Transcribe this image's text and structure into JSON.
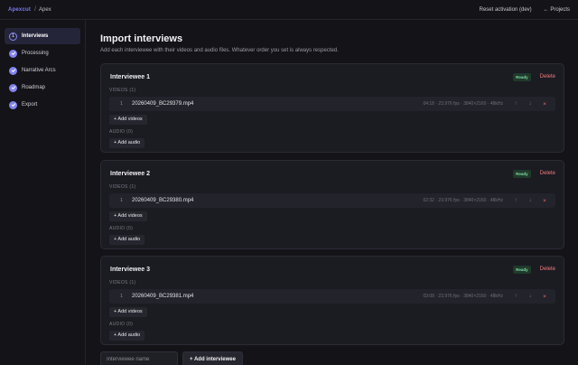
{
  "header": {
    "logo": "Apexcut",
    "separator": "/",
    "project": "Apex",
    "reset_label": "Reset activation (dev)",
    "projects_link": "← Projects"
  },
  "sidebar": {
    "items": [
      {
        "label": "Interviews",
        "icon": "step-1",
        "marker": "1",
        "active": true
      },
      {
        "label": "Processing",
        "icon": "check-icon",
        "marker": "",
        "active": false
      },
      {
        "label": "Narrative Arcs",
        "icon": "check-icon",
        "marker": "",
        "active": false
      },
      {
        "label": "Roadmap",
        "icon": "check-icon",
        "marker": "",
        "active": false
      },
      {
        "label": "Export",
        "icon": "check-icon",
        "marker": "",
        "active": false
      }
    ]
  },
  "main": {
    "title": "Import interviews",
    "subtitle": "Add each interviewee with their videos and audio files. Whatever order you set is always respected."
  },
  "labels": {
    "add_videos": "+ Add videos",
    "add_audio": "+ Add audio",
    "delete": "Delete",
    "move_up": "↑",
    "move_down": "↓",
    "remove": "×"
  },
  "interviewees": [
    {
      "name": "Interviewee 1",
      "status": "Ready",
      "videos_label": "VIDEOS (1)",
      "audio_label": "AUDIO (0)",
      "file": {
        "index": "1",
        "name": "20260409_BC29379.mp4",
        "meta": "04:18 · 23.976 fps · 3840×2160 · 48kHz"
      }
    },
    {
      "name": "Interviewee 2",
      "status": "Ready",
      "videos_label": "VIDEOS (1)",
      "audio_label": "AUDIO (0)",
      "file": {
        "index": "1",
        "name": "20260409_BC29380.mp4",
        "meta": "02:32 · 23.976 fps · 3840×2160 · 48kHz"
      }
    },
    {
      "name": "Interviewee 3",
      "status": "Ready",
      "videos_label": "VIDEOS (1)",
      "audio_label": "AUDIO (0)",
      "file": {
        "index": "1",
        "name": "20260409_BC29381.mp4",
        "meta": "03:08 · 23.976 fps · 3840×2160 · 48kHz"
      }
    }
  ],
  "footer": {
    "name_placeholder": "Interviewee name",
    "add_interviewee": "+ Add interviewee"
  },
  "colors": {
    "accent": "#8383ee",
    "ready_text": "#7fd9a0",
    "delete": "#f07b7b",
    "background": "#131318",
    "card": "#1b1b22"
  }
}
